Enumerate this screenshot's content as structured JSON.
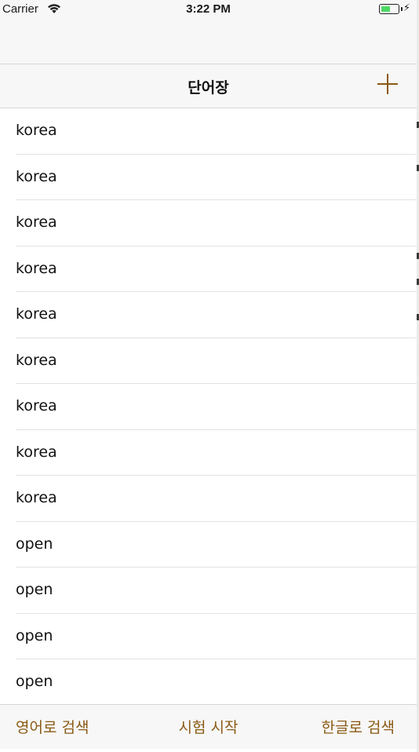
{
  "status_bar": {
    "carrier": "Carrier",
    "time": "3:22 PM",
    "battery_level": 0.6
  },
  "nav": {
    "title": "단어장",
    "add_icon": "plus-icon"
  },
  "words": [
    "korea",
    "korea",
    "korea",
    "korea",
    "korea",
    "korea",
    "korea",
    "korea",
    "korea",
    "open",
    "open",
    "open",
    "open"
  ],
  "toolbar": {
    "left": "영어로 검색",
    "center": "시험 시작",
    "right": "한글로 검색"
  },
  "colors": {
    "accent": "#8a5a14",
    "battery": "#4cd964"
  }
}
